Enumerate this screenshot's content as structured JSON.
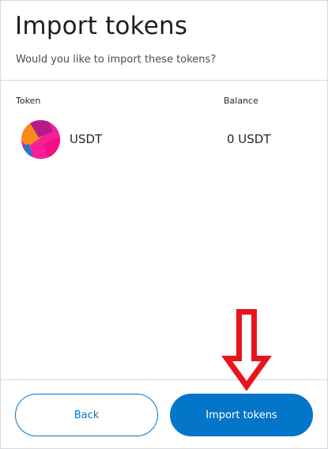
{
  "page": {
    "title": "Import tokens",
    "subtitle": "Would you like to import these tokens?"
  },
  "table": {
    "columns": [
      "Token",
      "Balance"
    ],
    "rows": [
      {
        "symbol": "USDT",
        "balance": "0 USDT",
        "icon": "token-identicon"
      }
    ]
  },
  "footer": {
    "back_label": "Back",
    "import_label": "Import tokens"
  },
  "colors": {
    "primary": "#0376c9",
    "annotation": "#e8141b"
  }
}
